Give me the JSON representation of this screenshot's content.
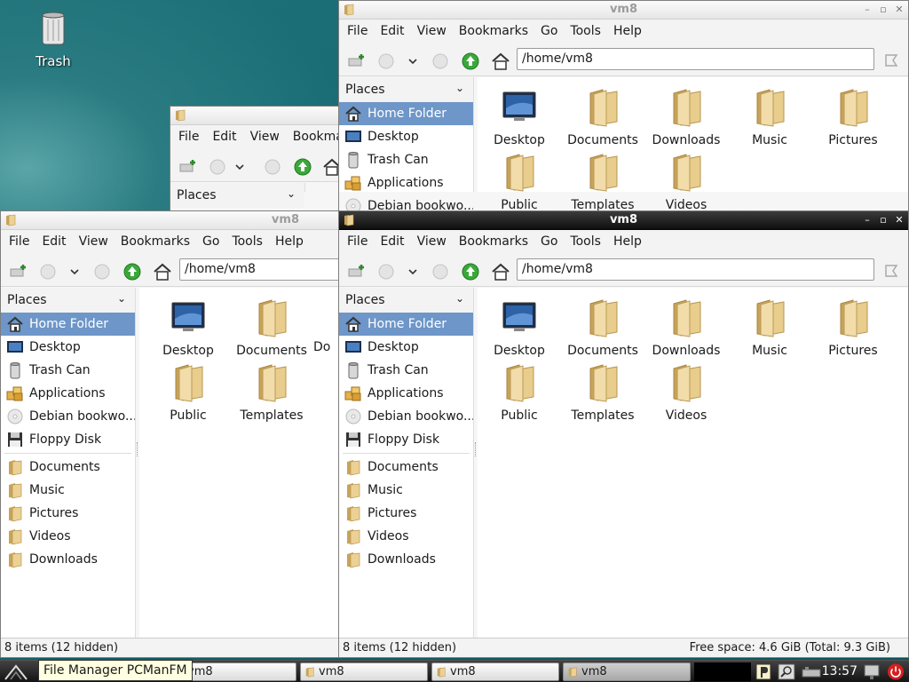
{
  "desktop": {
    "trash_label": "Trash"
  },
  "menu": [
    "File",
    "Edit",
    "View",
    "Bookmarks",
    "Go",
    "Tools",
    "Help"
  ],
  "menu_partial": [
    "File",
    "Edit",
    "View",
    "Bookmar"
  ],
  "window_title": "vm8",
  "path": "/home/vm8",
  "places_label": "Places",
  "places": [
    "Home Folder",
    "Desktop",
    "Trash Can",
    "Applications",
    "Debian bookwo...",
    "Floppy Disk"
  ],
  "bookmarks": [
    "Documents",
    "Music",
    "Pictures",
    "Videos",
    "Downloads"
  ],
  "files": [
    "Desktop",
    "Documents",
    "Downloads",
    "Music",
    "Pictures",
    "Public",
    "Templates",
    "Videos"
  ],
  "partial_file": "Do",
  "status": {
    "items": "8 items (12 hidden)",
    "free": "Free space: 4.6 GiB (Total: 9.3 GiB)"
  },
  "taskbar": {
    "tooltip": "File Manager PCManFM",
    "buttons": [
      "vm8",
      "vm8",
      "vm8",
      "vm8"
    ],
    "clock": "13:57"
  },
  "colors": {
    "selection": "#6e96c8",
    "desktop": "#1e7178",
    "folder": "#e2c27a"
  }
}
